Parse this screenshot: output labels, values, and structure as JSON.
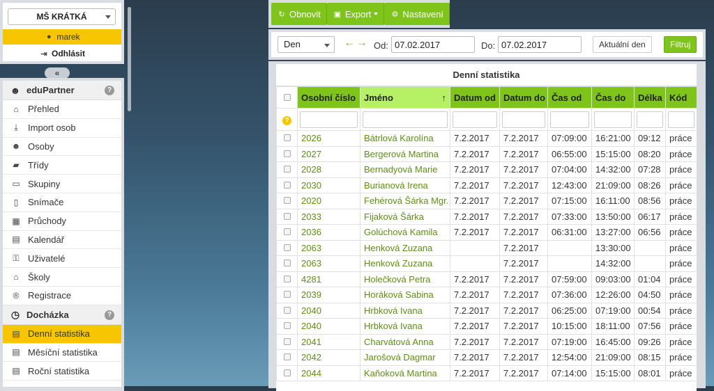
{
  "user_panel": {
    "school": "MŠ KRÁTKÁ",
    "username": "marek",
    "logout_label": "Odhlásit",
    "icons": {
      "user": "user-icon",
      "logout": "logout-icon",
      "collapse": "collapse-left-icon"
    },
    "collapse_label": "«"
  },
  "sidebar": {
    "section1": {
      "title": "eduPartner",
      "icon": "users-icon",
      "help": "?"
    },
    "items1": [
      {
        "label": "Přehled",
        "icon": "home-icon",
        "glyph": "⌂"
      },
      {
        "label": "Import osob",
        "icon": "download-icon",
        "glyph": "⤓"
      },
      {
        "label": "Osoby",
        "icon": "users-icon",
        "glyph": "☻"
      },
      {
        "label": "Třídy",
        "icon": "book-icon",
        "glyph": "▰"
      },
      {
        "label": "Skupiny",
        "icon": "folder-icon",
        "glyph": "▭"
      },
      {
        "label": "Snímače",
        "icon": "mobile-icon",
        "glyph": "▯"
      },
      {
        "label": "Průchody",
        "icon": "table-icon",
        "glyph": "▦"
      },
      {
        "label": "Kalendář",
        "icon": "calendar-icon",
        "glyph": "▤"
      },
      {
        "label": "Uživatelé",
        "icon": "lock-icon",
        "glyph": "⚿"
      },
      {
        "label": "Školy",
        "icon": "graduation-cap-icon",
        "glyph": "⌂"
      },
      {
        "label": "Registrace",
        "icon": "registered-icon",
        "glyph": "®"
      }
    ],
    "section2": {
      "title": "Docházka",
      "icon": "clock-icon",
      "help": "?"
    },
    "items2": [
      {
        "label": "Denní statistika",
        "icon": "calendar-icon",
        "glyph": "▤",
        "active": true
      },
      {
        "label": "Měsíční statistika",
        "icon": "calendar-icon",
        "glyph": "▤"
      },
      {
        "label": "Roční statistika",
        "icon": "calendar-icon",
        "glyph": "▤"
      }
    ]
  },
  "toolbar": {
    "refresh_label": "Obnovit",
    "export_label": "Export",
    "settings_label": "Nastavení",
    "icons": {
      "refresh": "refresh-icon",
      "export": "excel-icon",
      "settings": "gear-icon"
    }
  },
  "filter": {
    "period": "Den",
    "from_label": "Od:",
    "from_value": "07.02.2017",
    "to_label": "Do:",
    "to_value": "07.02.2017",
    "today_label": "Aktuální den",
    "filter_label": "Filtruj",
    "icons": {
      "prev": "arrow-left-icon",
      "next": "arrow-right-icon"
    }
  },
  "table": {
    "caption": "Denní statistika",
    "columns": [
      "Osobní číslo",
      "Jméno",
      "Datum od",
      "Datum do",
      "Čas od",
      "Čas do",
      "Délka",
      "Kód"
    ],
    "sorted_column": "Jméno",
    "rows": [
      [
        "2026",
        "Bátrlová Karolína",
        "7.2.2017",
        "7.2.2017",
        "07:09:00",
        "16:21:00",
        "09:12",
        "práce"
      ],
      [
        "2027",
        "Bergerová Martina",
        "7.2.2017",
        "7.2.2017",
        "06:55:00",
        "15:15:00",
        "08:20",
        "práce"
      ],
      [
        "2028",
        "Bernadyová Marie",
        "7.2.2017",
        "7.2.2017",
        "07:04:00",
        "14:32:00",
        "07:28",
        "práce"
      ],
      [
        "2030",
        "Burianová Irena",
        "7.2.2017",
        "7.2.2017",
        "12:43:00",
        "21:09:00",
        "08:26",
        "práce"
      ],
      [
        "2020",
        "Fehérová Šárka Mgr.",
        "7.2.2017",
        "7.2.2017",
        "07:15:00",
        "16:11:00",
        "08:56",
        "práce"
      ],
      [
        "2033",
        "Fijaková Šárka",
        "7.2.2017",
        "7.2.2017",
        "07:33:00",
        "13:50:00",
        "06:17",
        "práce"
      ],
      [
        "2036",
        "Golúchová Kamila",
        "7.2.2017",
        "7.2.2017",
        "06:31:00",
        "13:27:00",
        "06:56",
        "práce"
      ],
      [
        "2063",
        "Henková Zuzana",
        "",
        "7.2.2017",
        "",
        "13:30:00",
        "",
        "práce"
      ],
      [
        "2063",
        "Henková Zuzana",
        "",
        "7.2.2017",
        "",
        "14:32:00",
        "",
        "práce"
      ],
      [
        "4281",
        "Holečková Petra",
        "7.2.2017",
        "7.2.2017",
        "07:59:00",
        "09:03:00",
        "01:04",
        "práce"
      ],
      [
        "2039",
        "Horáková Sabina",
        "7.2.2017",
        "7.2.2017",
        "07:36:00",
        "12:26:00",
        "04:50",
        "práce"
      ],
      [
        "2040",
        "Hrbková Ivana",
        "7.2.2017",
        "7.2.2017",
        "06:25:00",
        "07:19:00",
        "00:54",
        "práce"
      ],
      [
        "2040",
        "Hrbková Ivana",
        "7.2.2017",
        "7.2.2017",
        "10:15:00",
        "18:11:00",
        "07:56",
        "práce"
      ],
      [
        "2041",
        "Charvátová Anna",
        "7.2.2017",
        "7.2.2017",
        "07:19:00",
        "16:45:00",
        "09:26",
        "práce"
      ],
      [
        "2042",
        "Jarošová Dagmar",
        "7.2.2017",
        "7.2.2017",
        "12:54:00",
        "21:09:00",
        "08:15",
        "práce"
      ],
      [
        "2044",
        "Kaňoková Martina",
        "7.2.2017",
        "7.2.2017",
        "07:14:00",
        "15:15:00",
        "08:01",
        "práce"
      ]
    ]
  }
}
